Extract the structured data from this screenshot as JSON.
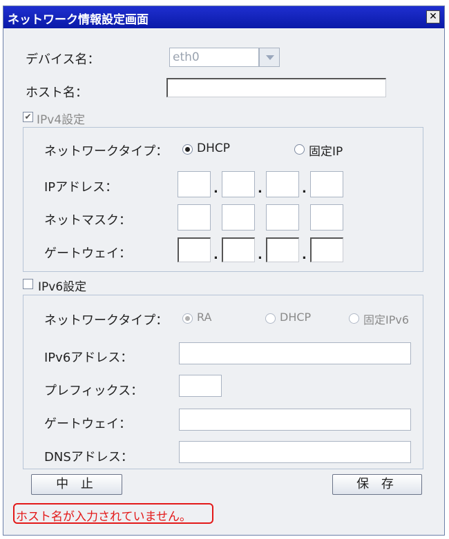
{
  "window": {
    "title": "ネットワーク情報設定画面",
    "close_label": "✕"
  },
  "device": {
    "label": "デバイス名：",
    "selected": "eth0"
  },
  "host": {
    "label": "ホスト名：",
    "value": ""
  },
  "ipv4": {
    "checkbox_label": "IPv4設定",
    "checked": true,
    "network_type_label": "ネットワークタイプ：",
    "options": [
      "DHCP",
      "固定IP"
    ],
    "selected": "DHCP",
    "ip_label": "IPアドレス：",
    "netmask_label": "ネットマスク：",
    "gateway_label": "ゲートウェイ：",
    "separator": "."
  },
  "ipv6": {
    "checkbox_label": "IPv6設定",
    "checked": false,
    "network_type_label": "ネットワークタイプ：",
    "options": [
      "RA",
      "DHCP",
      "固定IPv6"
    ],
    "selected": "RA",
    "address_label": "IPv6アドレス：",
    "prefix_label": "プレフィックス：",
    "gateway_label": "ゲートウェイ：",
    "dns_label": "DNSアドレス："
  },
  "buttons": {
    "cancel": "中 止",
    "save": "保 存"
  },
  "error": {
    "message": "ホスト名が入力されていません。",
    "color": "#e31818"
  },
  "colors": {
    "titlebar": "#1428c0",
    "background": "#eef0f3"
  }
}
